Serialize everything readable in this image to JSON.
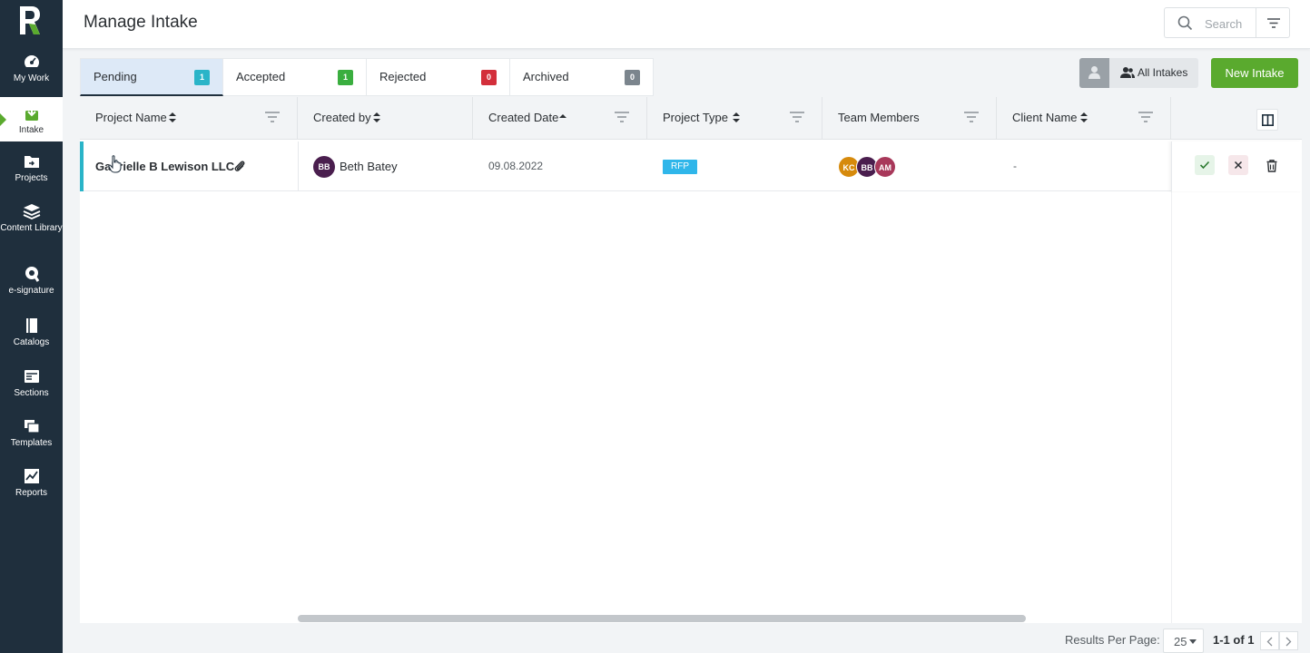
{
  "sidebar": {
    "logo_letter": "R",
    "items": [
      {
        "label": "My Work",
        "icon": "dashboard-gauge-icon"
      },
      {
        "label": "Intake",
        "icon": "intake-download-icon",
        "active": true
      },
      {
        "label": "Projects",
        "icon": "projects-folder-icon"
      },
      {
        "label": "Content Library",
        "icon": "content-library-stack-icon"
      },
      {
        "label": "e-signature",
        "icon": "e-signature-icon"
      },
      {
        "label": "Catalogs",
        "icon": "catalogs-book-icon"
      },
      {
        "label": "Sections",
        "icon": "sections-icon"
      },
      {
        "label": "Templates",
        "icon": "templates-icon"
      },
      {
        "label": "Reports",
        "icon": "reports-chart-icon"
      }
    ]
  },
  "header": {
    "title": "Manage Intake",
    "search_placeholder": "Search"
  },
  "tabs": [
    {
      "label": "Pending",
      "count": "1",
      "color": "#2ab4c8",
      "active": true
    },
    {
      "label": "Accepted",
      "count": "1",
      "color": "#3aae3f"
    },
    {
      "label": "Rejected",
      "count": "0",
      "color": "#d32f3b"
    },
    {
      "label": "Archived",
      "count": "0",
      "color": "#7b858d"
    }
  ],
  "toolbar": {
    "all_intakes_label": "All Intakes",
    "new_intake_label": "New Intake"
  },
  "table": {
    "columns": [
      {
        "label": "Project Name",
        "sort": "both"
      },
      {
        "label": "Created by",
        "sort": "both"
      },
      {
        "label": "Created Date",
        "sort": "asc"
      },
      {
        "label": "Project Type",
        "sort": "both"
      },
      {
        "label": "Team Members",
        "sort": "none"
      },
      {
        "label": "Client Name",
        "sort": "both"
      }
    ],
    "rows": [
      {
        "project_name": "Gabrielle B Lewison LLC",
        "created_by_initials": "BB",
        "created_by": "Beth Batey",
        "created_date": "09.08.2022",
        "project_type": "RFP",
        "team_members": [
          {
            "initials": "KC",
            "color": "#d68a0c"
          },
          {
            "initials": "BB",
            "color": "#4a1e4e"
          },
          {
            "initials": "AM",
            "color": "#a8385a"
          }
        ],
        "client_name": "-"
      }
    ]
  },
  "footer": {
    "results_per_page_label": "Results Per Page:",
    "per_page_value": "25",
    "page_info": "1-1 of 1"
  },
  "colors": {
    "sidebar_bg": "#1f2f3d",
    "accent_green": "#5aaa2e",
    "pending_teal": "#2ab4c8",
    "rfp_blue": "#2fb6ea"
  }
}
